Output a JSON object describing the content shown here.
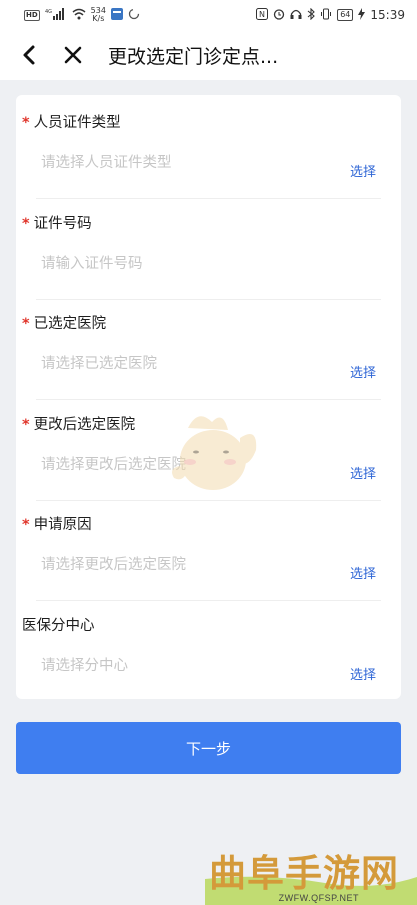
{
  "status_bar": {
    "network_badge": "HD",
    "signal": "4G",
    "speed_value": "534",
    "speed_unit": "K/s",
    "battery": "64",
    "time": "15:39"
  },
  "nav": {
    "back_icon": "chevron-left-icon",
    "close_icon": "close-icon",
    "title": "更改选定门诊定点..."
  },
  "form": {
    "fields": [
      {
        "label": "人员证件类型",
        "required": true,
        "placeholder": "请选择人员证件类型",
        "action": "选择"
      },
      {
        "label": "证件号码",
        "required": true,
        "placeholder": "请输入证件号码",
        "action": ""
      },
      {
        "label": "已选定医院",
        "required": true,
        "placeholder": "请选择已选定医院",
        "action": "选择"
      },
      {
        "label": "更改后选定医院",
        "required": true,
        "placeholder": "请选择更改后选定医院",
        "action": "选择"
      },
      {
        "label": "申请原因",
        "required": true,
        "placeholder": "请选择更改后选定医院",
        "action": "选择"
      },
      {
        "label": "医保分中心",
        "required": false,
        "placeholder": "请选择分中心",
        "action": "选择"
      }
    ],
    "required_mark": "*"
  },
  "next_button": {
    "label": "下一步"
  },
  "watermark": {
    "text": "曲阜手游网",
    "url": "ZWFW.QFSP.NET"
  },
  "colors": {
    "accent": "#3f7ef0",
    "action_text": "#2f66d6",
    "required": "#e0352b",
    "background": "#eef0f3"
  }
}
